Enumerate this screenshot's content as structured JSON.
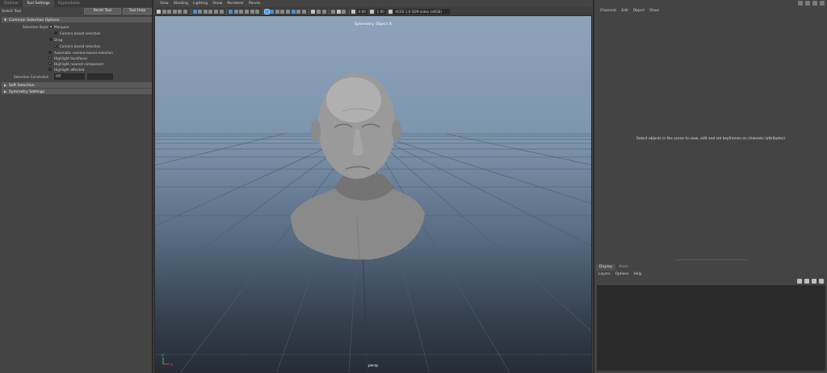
{
  "left_panel": {
    "tabs": [
      "Outliner",
      "Tool Settings",
      "Hypershade"
    ],
    "active_tab": "Tool Settings",
    "tool_name": "Select Tool",
    "reset_button": "Reset Tool",
    "help_button": "Tool Help",
    "sections": {
      "common": "Common Selection Options",
      "soft": "Soft Selection",
      "symmetry": "Symmetry Settings"
    },
    "selection_style_label": "Selection Style:",
    "marquee": "Marquee",
    "camera_based_selection_1": "Camera based selection",
    "drag": "Drag",
    "camera_based_selection_2": "Camera based selection",
    "automatic_camera_based": "Automatic camera-based selection",
    "highlight_backfaces": "Highlight backfaces",
    "highlight_nearest": "Highlight nearest component",
    "highlight_affected": "Highlight affected",
    "selection_constraint_label": "Selection Constraint:",
    "selection_constraint_value": "Off"
  },
  "viewport": {
    "menus": [
      "View",
      "Shading",
      "Lighting",
      "Show",
      "Renderer",
      "Panels"
    ],
    "value_1": "0.00",
    "value_2": "1.00",
    "colorspace": "ACES 1.0 SDR-video (sRGB)",
    "symmetry_label": "Symmetry: Object X",
    "camera_label": "persp",
    "axis_x": "x",
    "axis_y": "y"
  },
  "right_panel": {
    "channel_menus": [
      "Channels",
      "Edit",
      "Object",
      "Show"
    ],
    "message": "Select objects in the scene to view, edit and set keyframes on channels (attributes)",
    "layer_tabs": [
      "Display",
      "Anim"
    ],
    "active_layer_tab": "Display",
    "layer_menus": [
      "Layers",
      "Options",
      "Help"
    ]
  }
}
